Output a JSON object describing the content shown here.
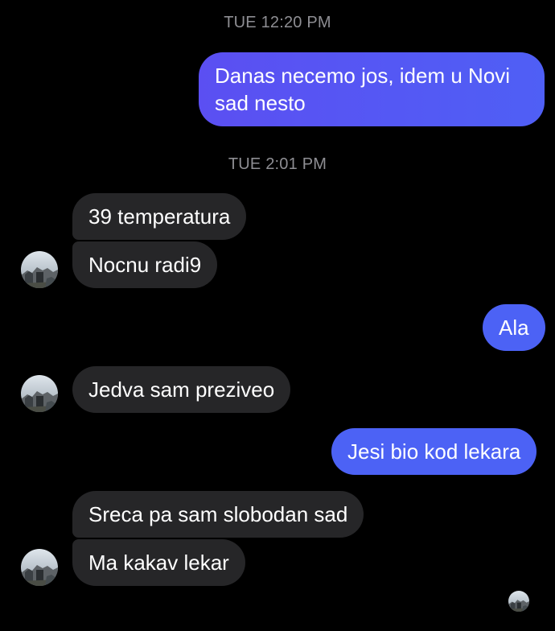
{
  "colors": {
    "background": "#000000",
    "outgoing_gradient_start": "#5b4ff2",
    "outgoing_solid": "#4c62f5",
    "incoming_bubble": "#262628",
    "timestamp": "#8e8e93"
  },
  "conversation": {
    "timestamp_1": "TUE 12:20 PM",
    "timestamp_2": "TUE 2:01 PM",
    "messages": [
      {
        "direction": "outgoing",
        "line1": "Danas necemo jos, idem u Novi",
        "line2": "sad nesto"
      },
      {
        "direction": "incoming",
        "text": "39 temperatura"
      },
      {
        "direction": "incoming",
        "text": "Nocnu radi9"
      },
      {
        "direction": "outgoing",
        "text": "Ala"
      },
      {
        "direction": "incoming",
        "text": "Jedva sam preziveo"
      },
      {
        "direction": "outgoing",
        "text": "Jesi bio kod lekara"
      },
      {
        "direction": "incoming",
        "text": "Sreca pa sam slobodan sad"
      },
      {
        "direction": "incoming",
        "text": "Ma kakav lekar"
      }
    ]
  },
  "icons": {
    "contact_avatar": "avatar-photo",
    "read_receipt": "avatar-photo-small"
  }
}
